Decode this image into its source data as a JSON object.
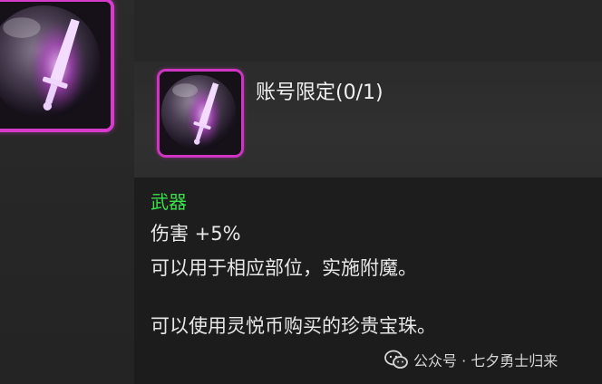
{
  "item": {
    "title": "账号限定(0/1)",
    "category": "武器",
    "stat": "伤害 +5%",
    "description_1": "可以用于相应部位，实施附魔。",
    "description_2": "可以使用灵悦币购买的珍贵宝珠。",
    "icon": "purple-orb-sword-icon"
  },
  "watermark": {
    "text": "公众号 · 七夕勇士归来",
    "icon": "wechat-icon"
  },
  "colors": {
    "frame": "#d63cc9",
    "category": "#39e04a",
    "text": "#e8e8e8"
  }
}
